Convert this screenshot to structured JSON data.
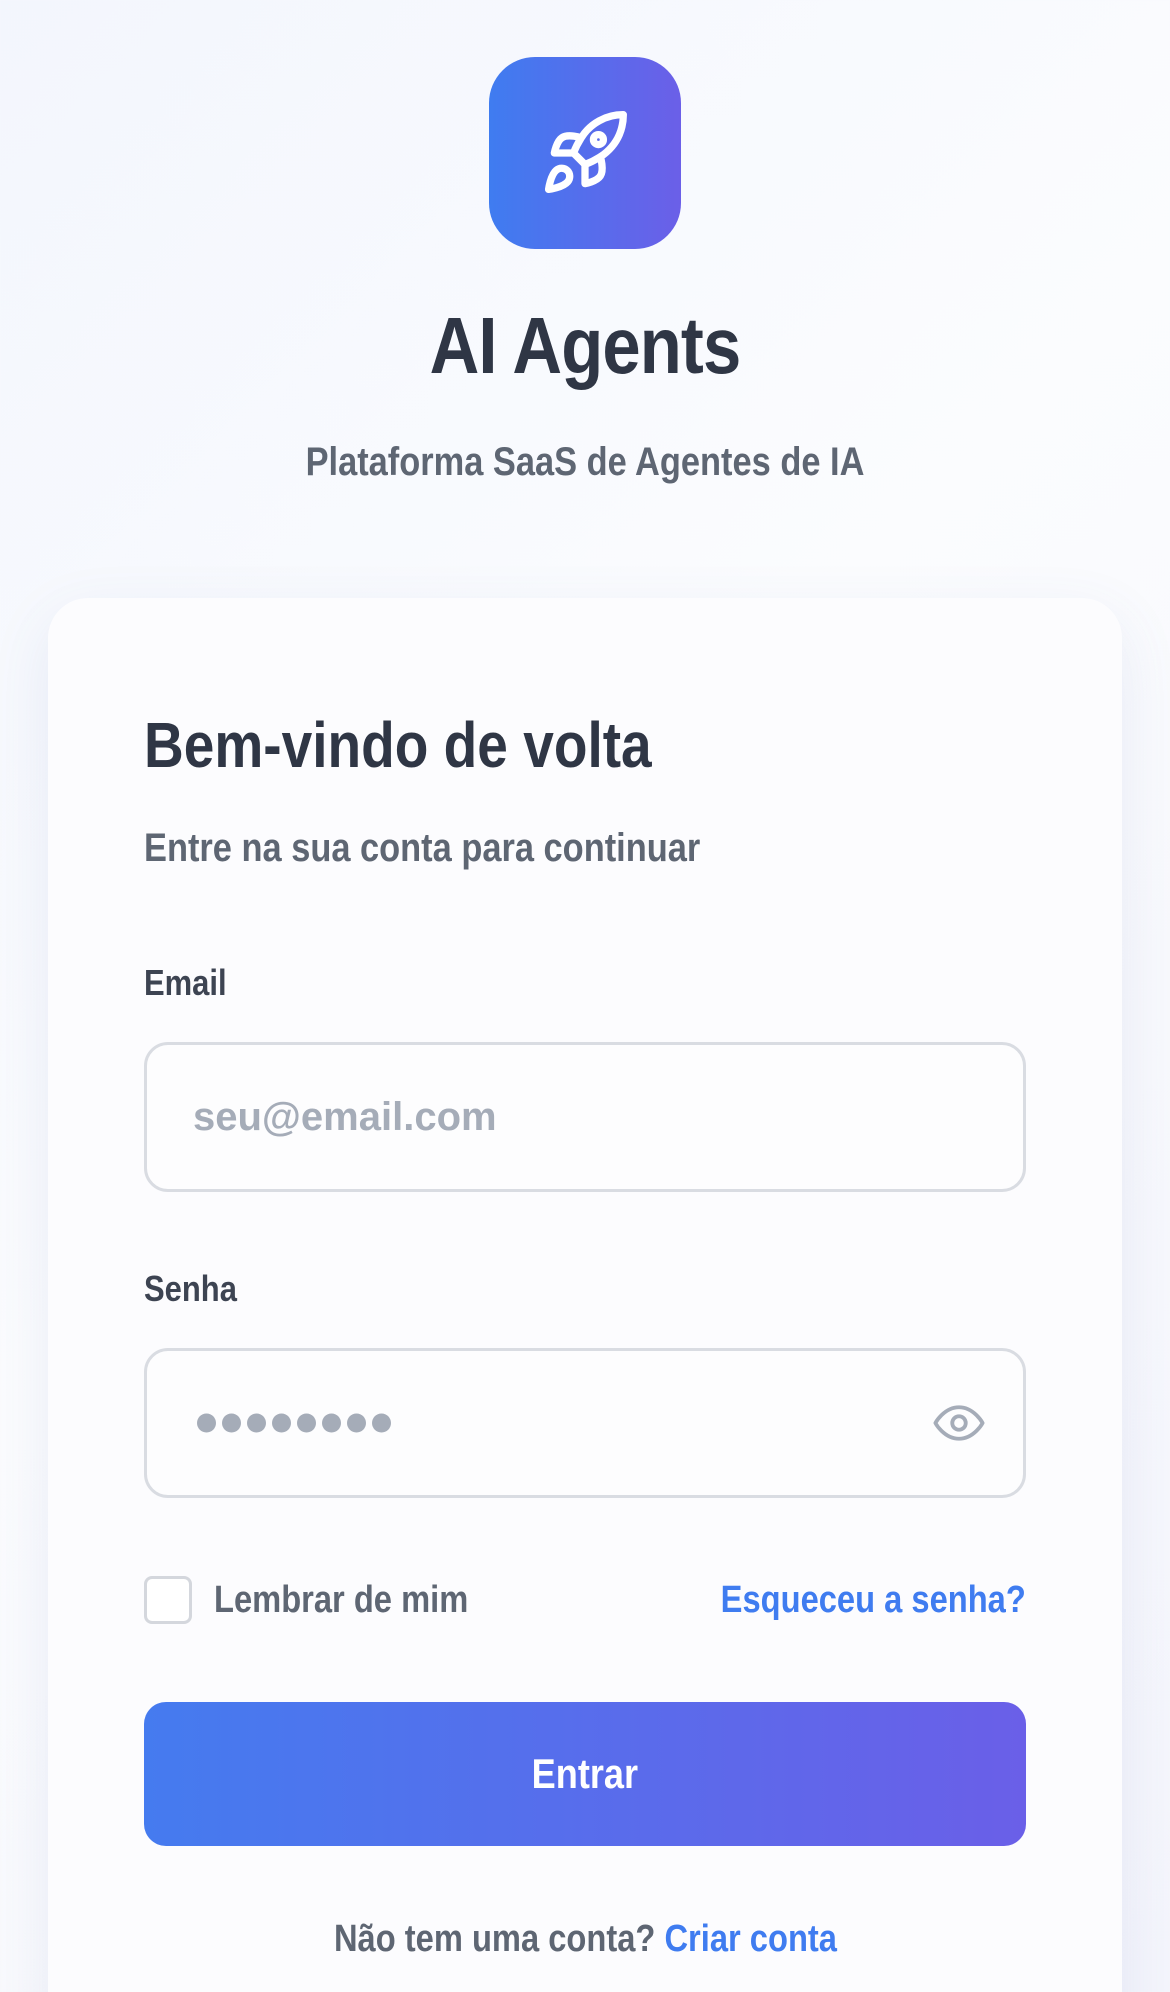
{
  "brand": {
    "icon": "rocket-icon",
    "title": "AI Agents",
    "subtitle": "Plataforma SaaS de Agentes de IA",
    "gradient_start": "#3f7cf0",
    "gradient_end": "#6b5fe8"
  },
  "login": {
    "title": "Bem-vindo de volta",
    "subtitle": "Entre na sua conta para continuar",
    "email_label": "Email",
    "email_placeholder": "seu@email.com",
    "email_value": "",
    "password_label": "Senha",
    "password_placeholder": "••••••••",
    "password_toggle_icon": "eye-icon",
    "remember_label": "Lembrar de mim",
    "remember_checked": false,
    "forgot_label": "Esqueceu a senha?",
    "submit_label": "Entrar",
    "signup_prompt": "Não tem uma conta?",
    "signup_link": "Criar conta"
  },
  "colors": {
    "accent": "#3f7cf0",
    "text_dark": "#2f3645",
    "text_muted": "#5e6673",
    "placeholder": "#a5acb8"
  }
}
